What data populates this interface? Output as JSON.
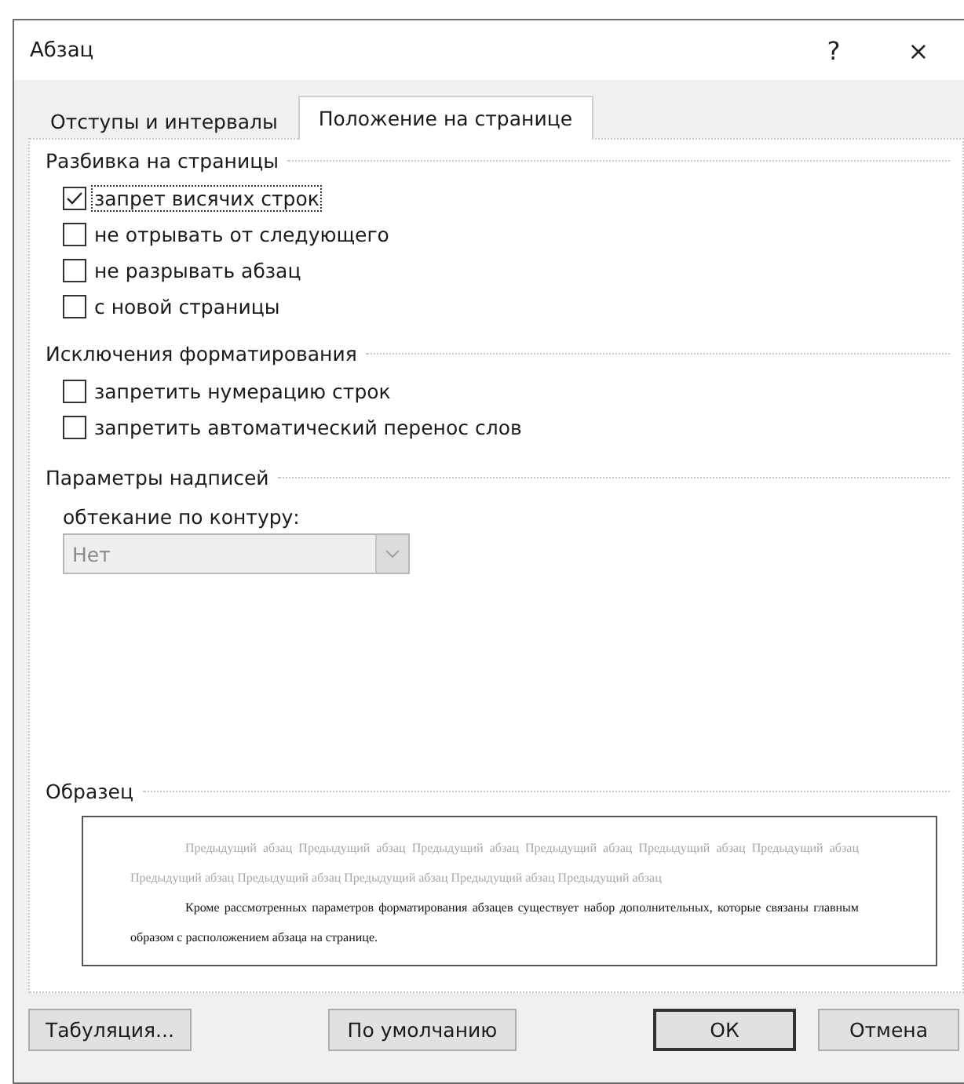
{
  "window": {
    "title": "Абзац",
    "help": "?",
    "close": "×"
  },
  "tabs": [
    {
      "label": "Отступы и интервалы",
      "selected": false
    },
    {
      "label": "Положение на странице",
      "selected": true
    }
  ],
  "sections": [
    {
      "title": "Разбивка на страницы",
      "options": [
        {
          "label": "запрет висячих строк",
          "checked": true,
          "focused": true
        },
        {
          "label": "не отрывать от следующего",
          "checked": false,
          "focused": false
        },
        {
          "label": "не разрывать абзац",
          "checked": false,
          "focused": false
        },
        {
          "label": "с новой страницы",
          "checked": false,
          "focused": false
        }
      ]
    },
    {
      "title": "Исключения форматирования",
      "options": [
        {
          "label": "запретить нумерацию строк",
          "checked": false,
          "focused": false
        },
        {
          "label": "запретить автоматический перенос слов",
          "checked": false,
          "focused": false
        }
      ]
    },
    {
      "title": "Параметры надписей",
      "field": {
        "label": "обтекание по контуру:",
        "value": "Нет",
        "disabled": true
      }
    }
  ],
  "preview": {
    "title": "Образец",
    "previous_paragraph": "Предыдущий абзац Предыдущий абзац Предыдущий абзац Предыдущий абзац Предыдущий абзац Предыдущий абзац Предыдущий абзац Предыдущий абзац Предыдущий абзац Предыдущий абзац Предыдущий абзац",
    "current_paragraph": "Кроме рассмотренных параметров форматирования абзацев существует набор дополнительных, которые связаны главным образом с расположением абзаца на странице."
  },
  "buttons": [
    {
      "label": "Табуляция...",
      "kind": "secondary"
    },
    {
      "label": "По умолчанию",
      "kind": "secondary"
    },
    {
      "label": "ОК",
      "kind": "default"
    },
    {
      "label": "Отмена",
      "kind": "secondary"
    }
  ]
}
